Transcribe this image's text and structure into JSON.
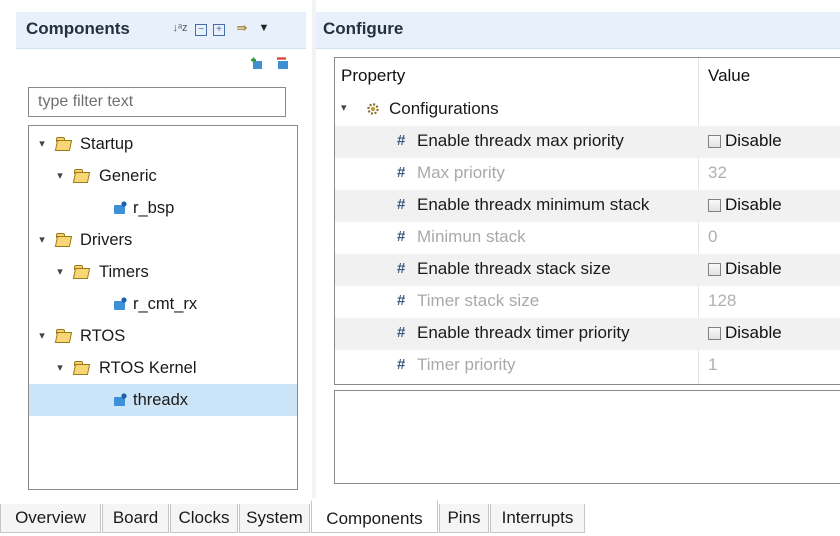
{
  "components_panel": {
    "title": "Components",
    "filter_placeholder": "type filter text",
    "tree": [
      {
        "label": "Startup",
        "type": "folder",
        "level": 0
      },
      {
        "label": "Generic",
        "type": "folder",
        "level": 1
      },
      {
        "label": "r_bsp",
        "type": "component",
        "level": 2
      },
      {
        "label": "Drivers",
        "type": "folder",
        "level": 0
      },
      {
        "label": "Timers",
        "type": "folder",
        "level": 1
      },
      {
        "label": "r_cmt_rx",
        "type": "component",
        "level": 2
      },
      {
        "label": "RTOS",
        "type": "folder",
        "level": 0
      },
      {
        "label": "RTOS Kernel",
        "type": "folder",
        "level": 1
      },
      {
        "label": "threadx",
        "type": "component",
        "level": 2,
        "selected": true
      }
    ]
  },
  "configure_panel": {
    "title": "Configure",
    "columns": {
      "property": "Property",
      "value": "Value"
    },
    "group_label": "Configurations",
    "properties": [
      {
        "name": "Enable threadx max priority",
        "value": "Disable",
        "kind": "checkbox",
        "enabled": true
      },
      {
        "name": "Max priority",
        "value": "32",
        "kind": "text",
        "enabled": false
      },
      {
        "name": "Enable threadx minimum stack",
        "value": "Disable",
        "kind": "checkbox",
        "enabled": true
      },
      {
        "name": "Minimun stack",
        "value": "0",
        "kind": "text",
        "enabled": false
      },
      {
        "name": "Enable threadx stack size",
        "value": "Disable",
        "kind": "checkbox",
        "enabled": true
      },
      {
        "name": "Timer stack size",
        "value": "128",
        "kind": "text",
        "enabled": false
      },
      {
        "name": "Enable threadx timer priority",
        "value": "Disable",
        "kind": "checkbox",
        "enabled": true
      },
      {
        "name": "Timer priority",
        "value": "1",
        "kind": "text",
        "enabled": false
      }
    ]
  },
  "tabs": [
    "Overview",
    "Board",
    "Clocks",
    "System",
    "Components",
    "Pins",
    "Interrupts"
  ],
  "active_tab": "Components",
  "colors": {
    "header_bg": "#e8f1fb",
    "selection_bg": "#cce4f7",
    "disabled_text": "#a9a9a9",
    "hash_icon": "#3b5a88"
  },
  "icons": {
    "sort": "sort-alpha-icon",
    "collapse_all": "collapse-all-icon",
    "expand_all": "expand-all-icon",
    "link": "link-editor-icon",
    "menu": "view-menu-icon",
    "add": "add-component-icon",
    "remove": "remove-component-icon"
  }
}
